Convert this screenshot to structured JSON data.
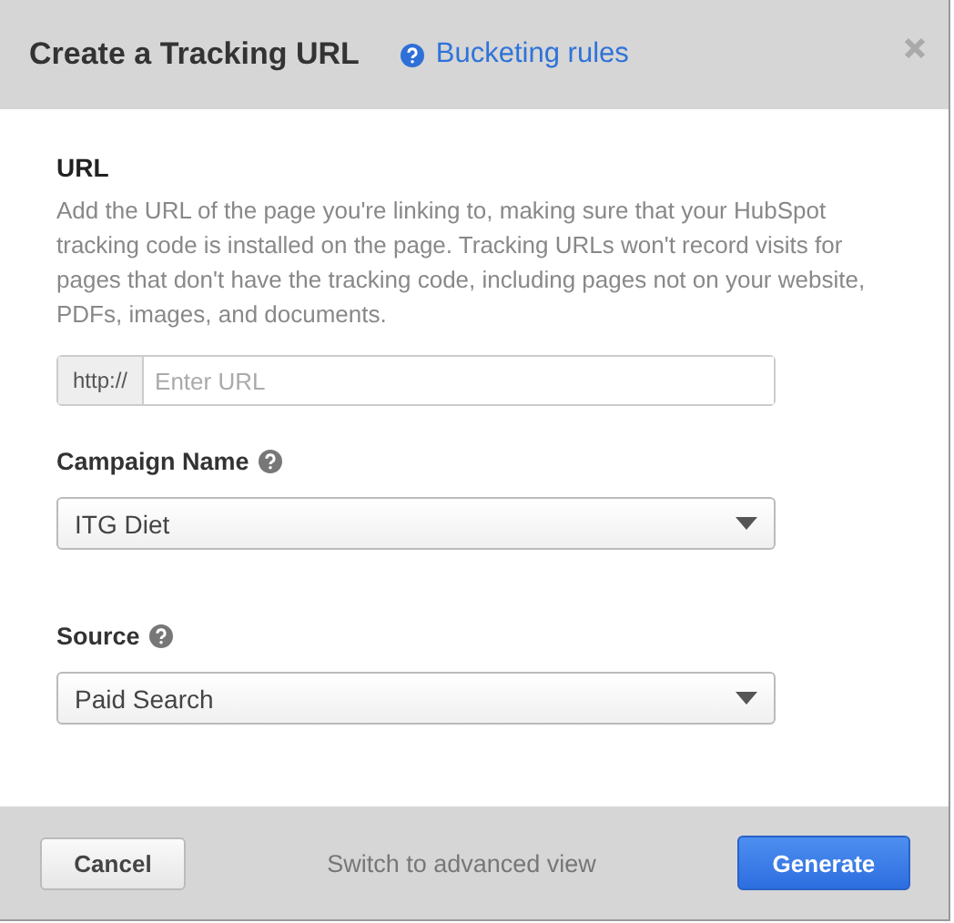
{
  "dialog": {
    "title": "Create a Tracking URL",
    "help_link": "Bucketing rules"
  },
  "url_section": {
    "label": "URL",
    "description": "Add the URL of the page you're linking to, making sure that your HubSpot tracking code is installed on the page. Tracking URLs won't record visits for pages that don't have the tracking code, including pages not on your website, PDFs, images, and documents.",
    "prefix": "http://",
    "placeholder": "Enter URL"
  },
  "selects": [
    {
      "label": "Campaign Name",
      "value": "ITG Diet"
    },
    {
      "label": "Source",
      "value": "Paid Search"
    }
  ],
  "footer": {
    "cancel": "Cancel",
    "link": "Switch to advanced view",
    "submit": "Generate"
  }
}
